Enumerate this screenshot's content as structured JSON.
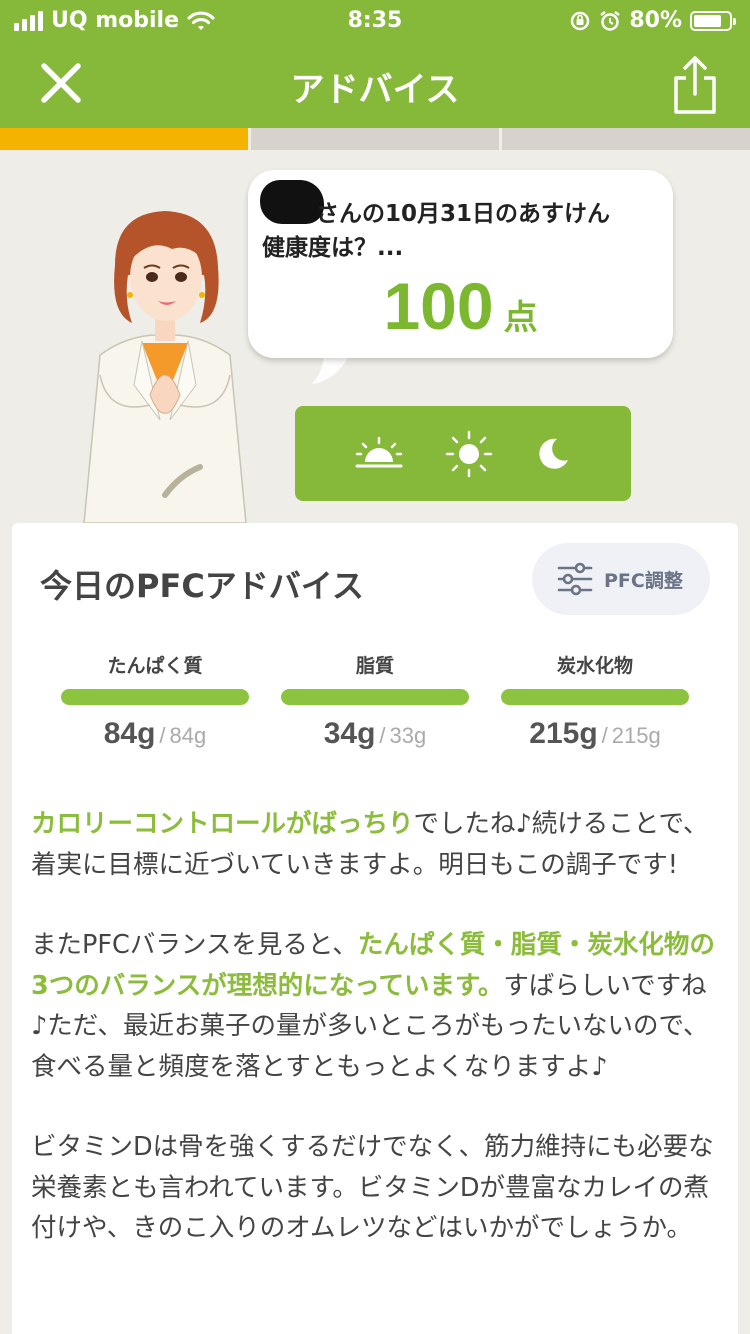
{
  "status_bar": {
    "carrier": "UQ mobile",
    "time": "8:35",
    "battery_text": "80%",
    "battery_level": 0.8
  },
  "nav": {
    "title": "アドバイス",
    "close_icon": "close-icon",
    "share_icon": "share-icon"
  },
  "progress": {
    "segments": 3,
    "active_index": 0,
    "active_color": "#f3b300"
  },
  "bubble": {
    "line1": "さんの10月31日のあすけん",
    "line2": "健康度は？...",
    "score": "100",
    "unit": "点"
  },
  "time_of_day": {
    "icons": [
      "sunrise-icon",
      "sun-icon",
      "moon-icon"
    ]
  },
  "card": {
    "title": "今日のPFCアドバイス",
    "pfc_button": "PFC調整",
    "nutrients": [
      {
        "label": "たんぱく質",
        "value": "84g",
        "separator": "/",
        "target": "84g",
        "fill": 1.0
      },
      {
        "label": "脂質",
        "value": "34g",
        "separator": "/",
        "target": "33g",
        "fill": 1.0
      },
      {
        "label": "炭水化物",
        "value": "215g",
        "separator": "/",
        "target": "215g",
        "fill": 1.0
      }
    ],
    "advice": {
      "p1_hl": "カロリーコントロールがばっちり",
      "p1_rest": "でしたね♪続けることで、着実に目標に近づいていきますよ。明日もこの調子です!",
      "p2_pre": "またPFCバランスを見ると、",
      "p2_hl": "たんぱく質・脂質・炭水化物の3つのバランスが理想的になっています。",
      "p2_rest": "すばらしいですね♪ただ、最近お菓子の量が多いところがもったいないので、食べる量と頻度を落とすともっとよくなりますよ♪",
      "p3": "ビタミンDは骨を強くするだけでなく、筋力維持にも必要な栄養素とも言われています。ビタミンDが豊富なカレイの煮付けや、きのこ入りのオムレツなどはいかがでしょうか。"
    }
  },
  "colors": {
    "brand_green": "#86b83a",
    "highlight_green": "#8cbc3b",
    "background": "#efede7"
  }
}
